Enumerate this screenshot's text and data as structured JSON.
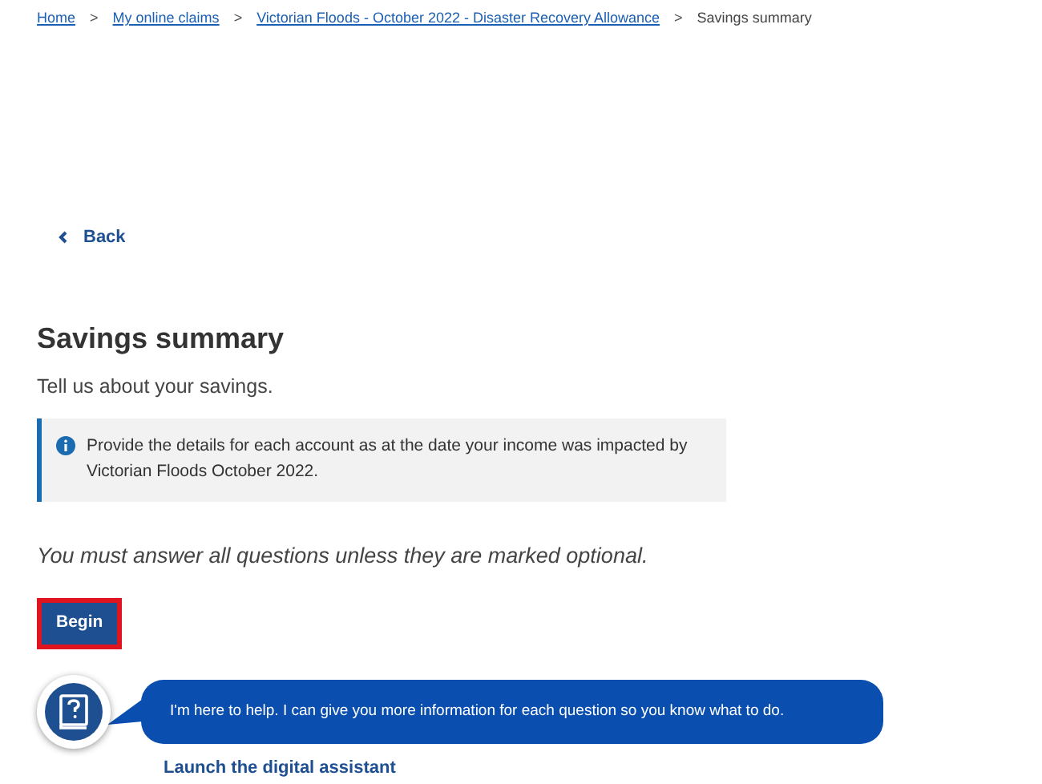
{
  "breadcrumbs": [
    {
      "label": "Home",
      "kind": "link"
    },
    {
      "label": "My online claims",
      "kind": "link"
    },
    {
      "label": "Victorian Floods - October 2022 - Disaster Recovery Allowance",
      "kind": "link"
    },
    {
      "label": "Savings summary",
      "kind": "current"
    }
  ],
  "separator": ">",
  "back_link": "Back",
  "heading": "Savings summary",
  "intro": "Tell us about your savings.",
  "info_box": "Provide the details for each account as at the date your income was impacted by Victorian Floods October 2022.",
  "instruction": "You must answer all questions unless they are marked optional.",
  "begin_button": {
    "label": "Begin",
    "focused": true
  },
  "assistant": {
    "message": "I'm here to help. I can give you more information for each question so you know what to do.",
    "link": "Launch the digital assistant"
  }
}
